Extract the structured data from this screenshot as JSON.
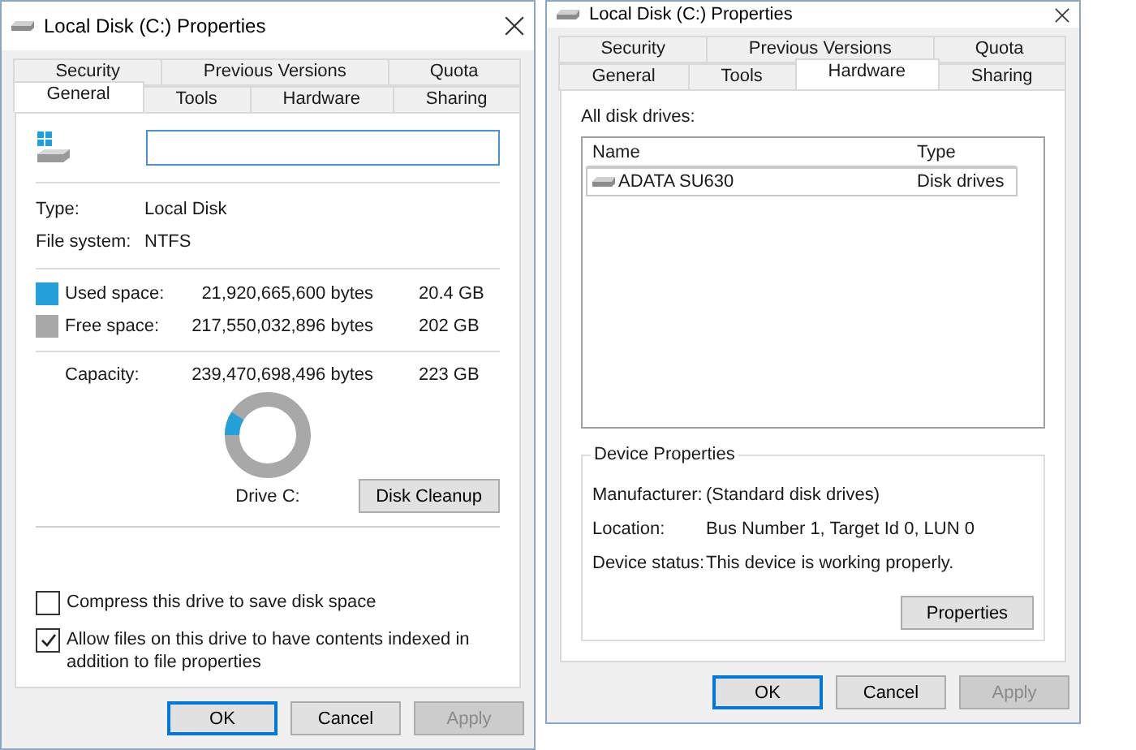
{
  "windows": [
    {
      "title": "Local Disk (C:) Properties",
      "tab_rows": [
        [
          {
            "label": "Security",
            "selected": false
          },
          {
            "label": "Previous Versions",
            "selected": false
          },
          {
            "label": "Quota",
            "selected": false
          }
        ],
        [
          {
            "label": "General",
            "selected": true
          },
          {
            "label": "Tools",
            "selected": false
          },
          {
            "label": "Hardware",
            "selected": false
          },
          {
            "label": "Sharing",
            "selected": false
          }
        ]
      ],
      "page": {
        "kind": "general",
        "info": [
          {
            "label": "Type:",
            "value": "Local Disk"
          },
          {
            "label": "File system:",
            "value": "NTFS"
          }
        ],
        "space": [
          {
            "label": "Used space:",
            "bytes": "21,920,665,600 bytes",
            "size": "20.4 GB",
            "color": "#26a0da"
          },
          {
            "label": "Free space:",
            "bytes": "217,550,032,896 bytes",
            "size": "202 GB",
            "color": "#a8a8a8"
          }
        ],
        "capacity": {
          "label": "Capacity:",
          "bytes": "239,470,698,496 bytes",
          "size": "223 GB"
        },
        "usage": {
          "level": 0.09
        },
        "drive_label": "Drive C:",
        "cleanup_button": "Disk Cleanup",
        "options": [
          {
            "label": "Compress this drive to save disk space",
            "checked": false
          },
          {
            "label": "Allow files on this drive to have contents indexed in addition to file properties",
            "checked": true
          }
        ]
      },
      "buttons": [
        {
          "label": "OK",
          "default": true,
          "disabled": false
        },
        {
          "label": "Cancel",
          "default": false,
          "disabled": false
        },
        {
          "label": "Apply",
          "default": false,
          "disabled": true
        }
      ]
    },
    {
      "title": "Local Disk (C:) Properties",
      "tab_rows": [
        [
          {
            "label": "Security",
            "selected": false
          },
          {
            "label": "Previous Versions",
            "selected": false
          },
          {
            "label": "Quota",
            "selected": false
          }
        ],
        [
          {
            "label": "General",
            "selected": false
          },
          {
            "label": "Tools",
            "selected": false
          },
          {
            "label": "Hardware",
            "selected": true
          },
          {
            "label": "Sharing",
            "selected": false
          }
        ]
      ],
      "page": {
        "kind": "hardware",
        "list_label": "All disk drives:",
        "columns": [
          "Name",
          "Type"
        ],
        "rows": [
          {
            "cells": [
              "ADATA SU630",
              "Disk drives"
            ],
            "selected": true
          }
        ],
        "group_title": "Device Properties",
        "fields": [
          {
            "label": "Manufacturer:",
            "value": "(Standard disk drives)"
          },
          {
            "label": "Location:",
            "value": "Bus Number 1, Target Id 0, LUN 0"
          },
          {
            "label": "Device status:",
            "value": "This device is working properly."
          }
        ],
        "properties_button": "Properties"
      },
      "buttons": [
        {
          "label": "OK",
          "default": true,
          "disabled": false
        },
        {
          "label": "Cancel",
          "default": false,
          "disabled": false
        },
        {
          "label": "Apply",
          "default": false,
          "disabled": true
        }
      ]
    }
  ]
}
